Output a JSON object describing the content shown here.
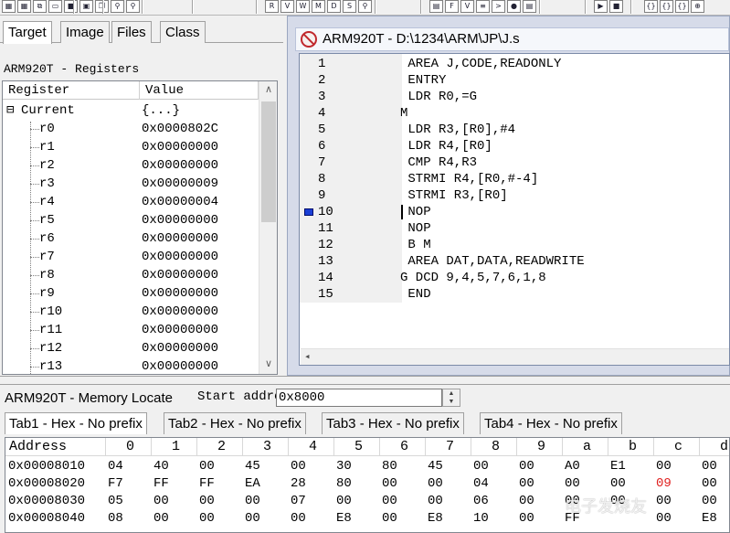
{
  "toolbar": {
    "buttons": [
      {
        "icon": "bitmap-view-icon",
        "glyph": "▦"
      },
      {
        "icon": "bitmap-view-icon",
        "glyph": "▦"
      },
      {
        "icon": "bitmap-copy-icon",
        "glyph": "⧉"
      },
      {
        "icon": "open-folder-icon",
        "glyph": "▭"
      },
      {
        "icon": "save-icon",
        "glyph": "■"
      },
      {
        "icon": "save-all-icon",
        "glyph": "▣"
      },
      {
        "icon": "copy-icon",
        "glyph": "❐"
      },
      {
        "icon": "find-icon",
        "glyph": "⚲"
      },
      {
        "icon": "find-next-icon",
        "glyph": "⚲"
      },
      {
        "icon": "register-window-icon",
        "glyph": "R"
      },
      {
        "icon": "variable-window-icon",
        "glyph": "V"
      },
      {
        "icon": "watch-window-icon",
        "glyph": "W"
      },
      {
        "icon": "memory-window-icon",
        "glyph": "M"
      },
      {
        "icon": "disassembly-window-icon",
        "glyph": "D"
      },
      {
        "icon": "source-window-icon",
        "glyph": "S"
      },
      {
        "icon": "zoom-window-icon",
        "glyph": "⚲"
      },
      {
        "icon": "code-view-icon",
        "glyph": "▤"
      },
      {
        "icon": "file-view-icon",
        "glyph": "F"
      },
      {
        "icon": "variable-view-icon",
        "glyph": "V"
      },
      {
        "icon": "list-view-icon",
        "glyph": "≡"
      },
      {
        "icon": "command-window-icon",
        "glyph": ">"
      },
      {
        "icon": "breakpoint-view-icon",
        "glyph": "●"
      },
      {
        "icon": "log-view-icon",
        "glyph": "▤"
      },
      {
        "icon": "run-icon",
        "glyph": "▶"
      },
      {
        "icon": "stop-icon",
        "glyph": "■"
      },
      {
        "icon": "step-icon",
        "glyph": "{}"
      },
      {
        "icon": "step-over-icon",
        "glyph": "{}"
      },
      {
        "icon": "step-out-icon",
        "glyph": "{}"
      },
      {
        "icon": "step-to-icon",
        "glyph": "⊕"
      }
    ]
  },
  "left_tabs": [
    "Target",
    "Image",
    "Files",
    "Class"
  ],
  "registers": {
    "title": "ARM920T - Registers",
    "col_register": "Register",
    "col_value": "Value",
    "group": {
      "expander": "⊟",
      "name": "Current",
      "value": "{...}"
    },
    "rows": [
      {
        "name": "r0",
        "value": "0x0000802C"
      },
      {
        "name": "r1",
        "value": "0x00000000"
      },
      {
        "name": "r2",
        "value": "0x00000000"
      },
      {
        "name": "r3",
        "value": "0x00000009"
      },
      {
        "name": "r4",
        "value": "0x00000004"
      },
      {
        "name": "r5",
        "value": "0x00000000"
      },
      {
        "name": "r6",
        "value": "0x00000000"
      },
      {
        "name": "r7",
        "value": "0x00000000"
      },
      {
        "name": "r8",
        "value": "0x00000000"
      },
      {
        "name": "r9",
        "value": "0x00000000"
      },
      {
        "name": "r10",
        "value": "0x00000000"
      },
      {
        "name": "r11",
        "value": "0x00000000"
      },
      {
        "name": "r12",
        "value": "0x00000000"
      },
      {
        "name": "r13",
        "value": "0x00000000"
      }
    ],
    "scroll_up": "∧",
    "scroll_down": "∨"
  },
  "editor": {
    "title": "ARM920T - D:\\1234\\ARM\\JP\\J.s",
    "current_line": 10,
    "lines": [
      {
        "num": "1",
        "text": " AREA J,CODE,READONLY"
      },
      {
        "num": "2",
        "text": " ENTRY"
      },
      {
        "num": "3",
        "text": " LDR R0,=G"
      },
      {
        "num": "4",
        "text": "M"
      },
      {
        "num": "5",
        "text": " LDR R3,[R0],#4"
      },
      {
        "num": "6",
        "text": " LDR R4,[R0]"
      },
      {
        "num": "7",
        "text": " CMP R4,R3"
      },
      {
        "num": "8",
        "text": " STRMI R4,[R0,#-4]"
      },
      {
        "num": "9",
        "text": " STRMI R3,[R0]"
      },
      {
        "num": "10",
        "text": " NOP"
      },
      {
        "num": "11",
        "text": " NOP"
      },
      {
        "num": "12",
        "text": " B M"
      },
      {
        "num": "13",
        "text": " AREA DAT,DATA,READWRITE"
      },
      {
        "num": "14",
        "text": "G DCD 9,4,5,7,6,1,8"
      },
      {
        "num": "15",
        "text": " END"
      }
    ],
    "hscroll_left": "◂"
  },
  "memory": {
    "title": "ARM920T - Memory Locate",
    "start_label": "Start addre",
    "start_value": "0x8000",
    "spin_up": "▲",
    "spin_down": "▼",
    "tabs": [
      "Tab1 - Hex - No prefix",
      "Tab2 - Hex - No prefix",
      "Tab3 - Hex - No prefix",
      "Tab4 - Hex - No prefix"
    ],
    "columns": [
      "Address",
      "0",
      "1",
      "2",
      "3",
      "4",
      "5",
      "6",
      "7",
      "8",
      "9",
      "a",
      "b",
      "c",
      "d"
    ],
    "rows": [
      {
        "address": "0x00008010",
        "bytes": [
          "04",
          "40",
          "00",
          "45",
          "00",
          "30",
          "80",
          "45",
          "00",
          "00",
          "A0",
          "E1",
          "00",
          "00"
        ]
      },
      {
        "address": "0x00008020",
        "bytes": [
          "F7",
          "FF",
          "FF",
          "EA",
          "28",
          "80",
          "00",
          "00",
          "04",
          "00",
          "00",
          "00",
          "09",
          "00"
        ]
      },
      {
        "address": "0x00008030",
        "bytes": [
          "05",
          "00",
          "00",
          "00",
          "07",
          "00",
          "00",
          "00",
          "06",
          "00",
          "00",
          "00",
          "00",
          "00"
        ]
      },
      {
        "address": "0x00008040",
        "bytes": [
          "08",
          "00",
          "00",
          "00",
          "00",
          "E8",
          "00",
          "E8",
          "10",
          "00",
          "FF",
          "",
          "00",
          "E8"
        ]
      }
    ],
    "changed_color": "#e0201f",
    "changed_cells": [
      [
        1,
        12
      ]
    ]
  },
  "watermark": "电子发烧友"
}
